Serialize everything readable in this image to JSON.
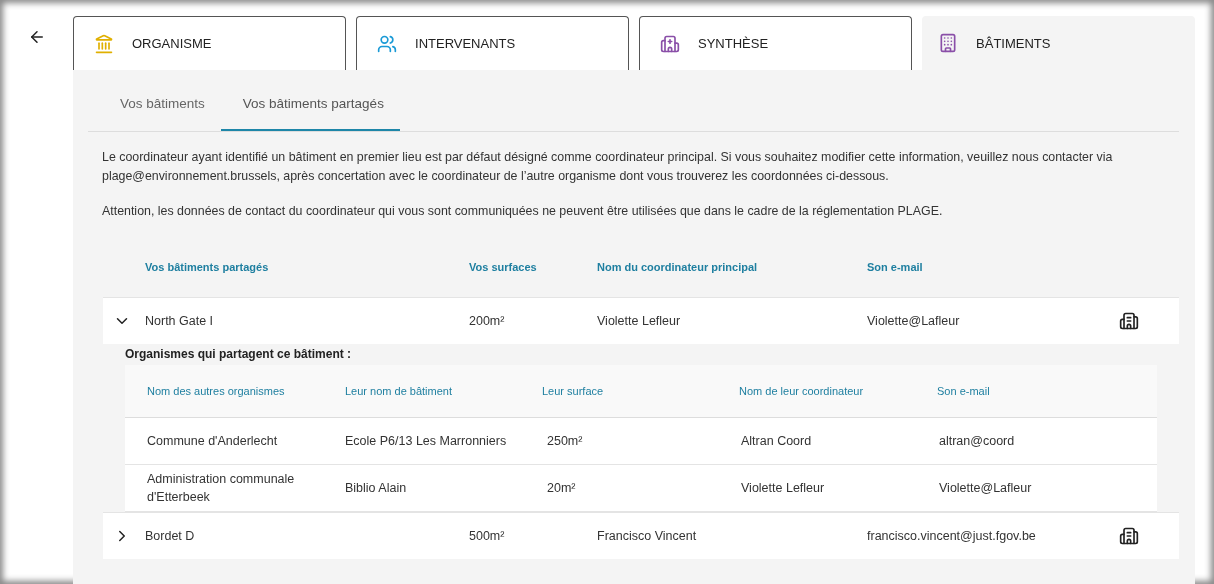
{
  "tabs": [
    {
      "label": "ORGANISME",
      "kind": "institution",
      "selected": false
    },
    {
      "label": "INTERVENANTS",
      "kind": "people",
      "selected": false
    },
    {
      "label": "SYNTHÈSE",
      "kind": "hospital",
      "selected": false
    },
    {
      "label": "BÂTIMENTS",
      "kind": "building",
      "selected": true
    }
  ],
  "subtabs": [
    {
      "label": "Vos bâtiments",
      "selected": false
    },
    {
      "label": "Vos bâtiments partagés",
      "selected": true
    }
  ],
  "paragraphs": [
    "Le coordinateur ayant identifié un bâtiment en premier lieu est par défaut désigné comme coordinateur principal. Si vous souhaitez modifier cette information, veuillez nous contacter via plage@environnement.brussels, après concertation avec le coordinateur de l’autre organisme dont vous trouverez les coordonnées ci-dessous.",
    "Attention, les données de contact du coordinateur qui vous sont communiquées ne peuvent être utilisées que dans le cadre de la réglementation PLAGE."
  ],
  "table": {
    "columns": [
      "Vos bâtiments partagés",
      "Vos surfaces",
      "Nom du coordinateur principal",
      "Son e-mail"
    ],
    "rows": [
      {
        "expanded": true,
        "cells": [
          "North Gate I",
          "200m²",
          "Violette Lefleur",
          "Violette@Lafleur"
        ],
        "shared": {
          "title": "Organismes qui partagent ce bâtiment :",
          "columns": [
            "Nom des autres organismes",
            "Leur nom de bâtiment",
            "Leur surface",
            "Nom de leur coordinateur",
            "Son e-mail"
          ],
          "rows": [
            [
              "Commune d'Anderlecht",
              "Ecole P6/13 Les Marronniers",
              "250m²",
              "Altran Coord",
              "altran@coord"
            ],
            [
              "Administration communale d'Etterbeek",
              "Biblio Alain",
              "20m²",
              "Violette Lefleur",
              "Violette@Lafleur"
            ]
          ]
        }
      },
      {
        "expanded": false,
        "cells": [
          "Bordet D",
          "500m²",
          "Francisco Vincent",
          "francisco.vincent@just.fgov.be"
        ]
      }
    ]
  }
}
